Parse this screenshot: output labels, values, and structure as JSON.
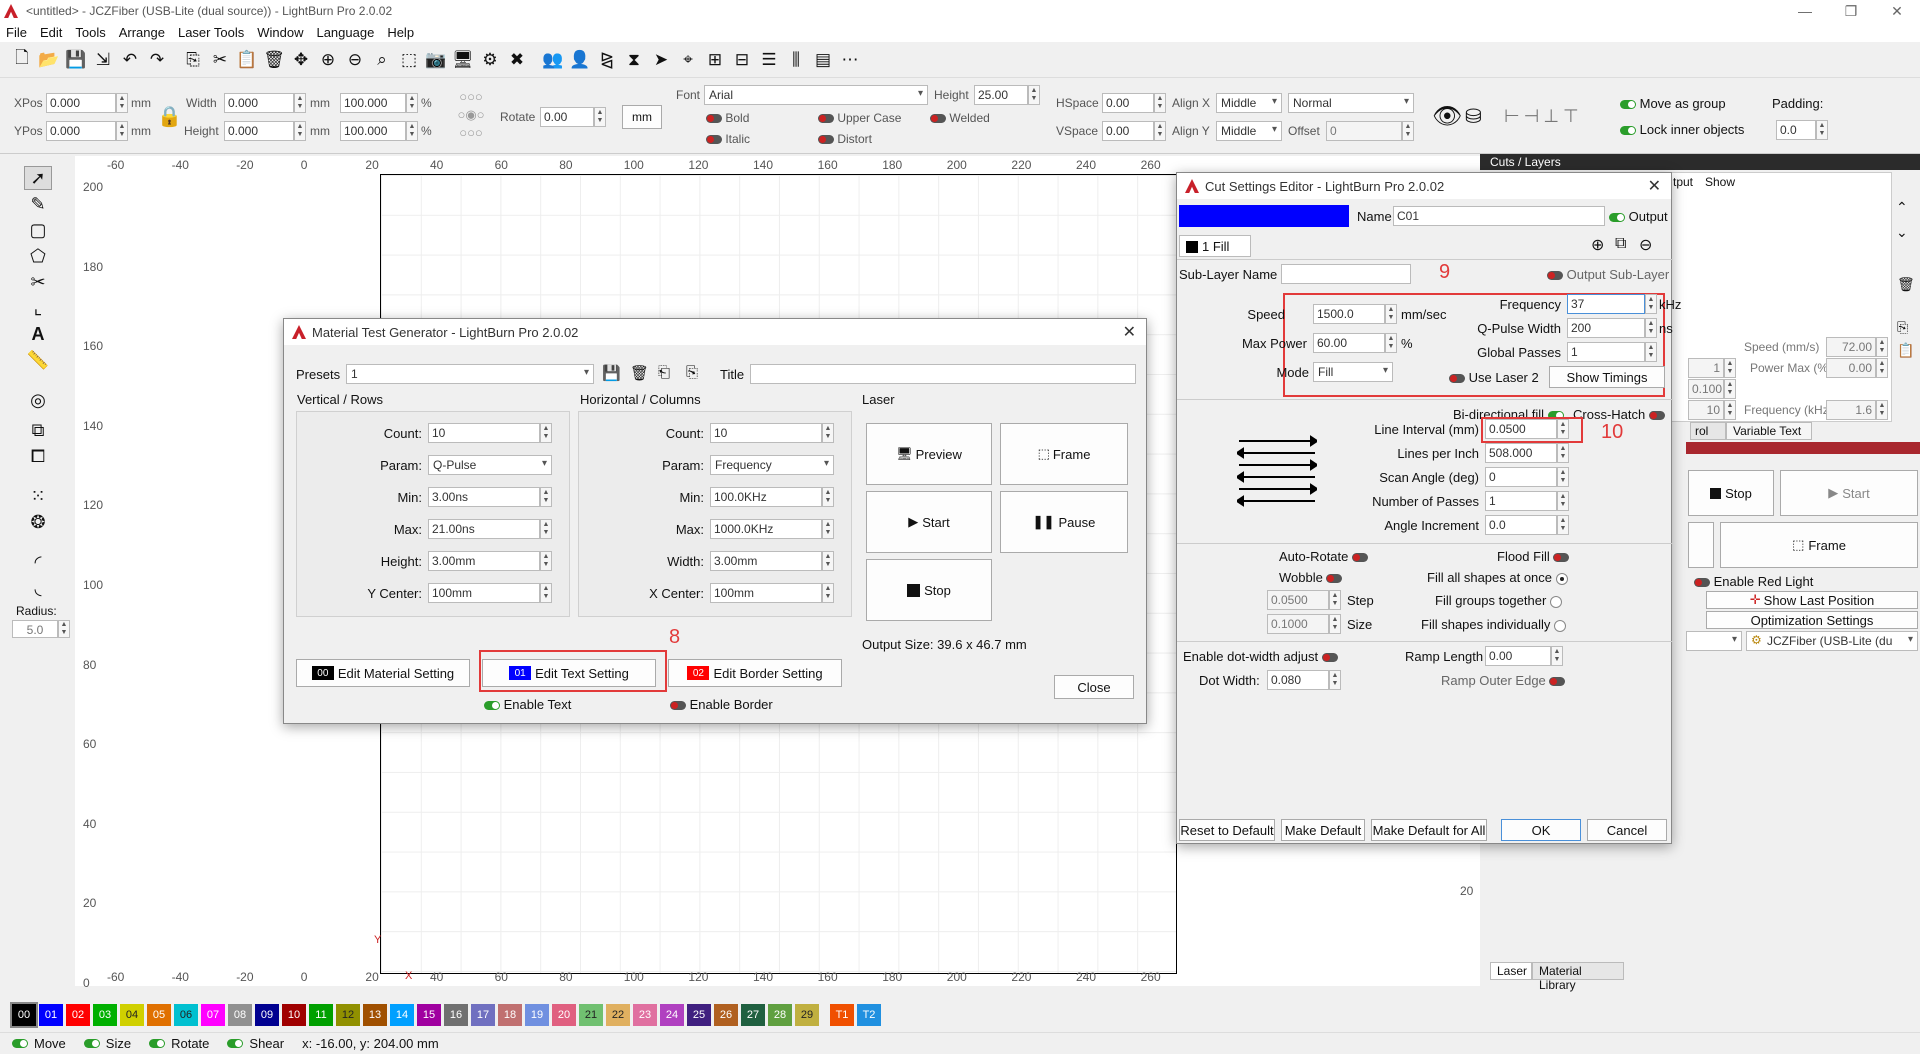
{
  "window": {
    "title": "<untitled> - JCZFiber (USB-Lite (dual source)) - LightBurn Pro 2.0.02",
    "minimize": "—",
    "maximize": "❐",
    "close": "✕"
  },
  "menu": [
    "File",
    "Edit",
    "Tools",
    "Arrange",
    "Laser Tools",
    "Window",
    "Language",
    "Help"
  ],
  "props": {
    "xpos_label": "XPos",
    "xpos": "0.000",
    "ypos_label": "YPos",
    "ypos": "0.000",
    "mm": "mm",
    "width_label": "Width",
    "width": "0.000",
    "height_label": "Height",
    "height": "0.000",
    "wpct": "100.000",
    "hpct": "100.000",
    "pct": "%",
    "rotate_label": "Rotate",
    "rotate": "0.00",
    "unit_btn": "mm",
    "font_label": "Font",
    "font": "Arial",
    "fheight_label": "Height",
    "fheight": "25.00",
    "bold": "Bold",
    "italic": "Italic",
    "upper": "Upper Case",
    "distort": "Distort",
    "welded": "Welded",
    "hspace_label": "HSpace",
    "hspace": "0.00",
    "vspace_label": "VSpace",
    "vspace": "0.00",
    "alignx_label": "Align X",
    "alignx": "Middle",
    "aligny_label": "Align Y",
    "aligny": "Middle",
    "normal": "Normal",
    "offset_label": "Offset",
    "offset": "0",
    "move_group": "Move as group",
    "lock_inner": "Lock inner objects",
    "padding_label": "Padding:",
    "padding": "0.0"
  },
  "rulers": {
    "top": [
      "-60",
      "-40",
      "-20",
      "0",
      "20",
      "40",
      "60",
      "80",
      "100",
      "120",
      "140",
      "160",
      "180",
      "200",
      "220",
      "240",
      "260"
    ],
    "left": [
      "200",
      "180",
      "160",
      "140",
      "120",
      "100",
      "80",
      "60",
      "40",
      "20",
      "0"
    ],
    "left_small": [
      "20"
    ],
    "bottom": [
      "-60",
      "-40",
      "-20",
      "0",
      "20",
      "40",
      "60",
      "80",
      "100",
      "120",
      "140",
      "160",
      "180",
      "200",
      "220",
      "240",
      "260"
    ],
    "x_marker": "X",
    "y_marker": "Y"
  },
  "radius": {
    "label": "Radius:",
    "value": "5.0"
  },
  "palette": [
    {
      "n": "00",
      "c": "#000000"
    },
    {
      "n": "01",
      "c": "#0000ff"
    },
    {
      "n": "02",
      "c": "#ff0000"
    },
    {
      "n": "03",
      "c": "#00b000"
    },
    {
      "n": "04",
      "c": "#d0d000"
    },
    {
      "n": "05",
      "c": "#e07000"
    },
    {
      "n": "06",
      "c": "#00c0d0"
    },
    {
      "n": "07",
      "c": "#ff00ff"
    },
    {
      "n": "08",
      "c": "#909090"
    },
    {
      "n": "09",
      "c": "#000090"
    },
    {
      "n": "10",
      "c": "#a00000"
    },
    {
      "n": "11",
      "c": "#00a000"
    },
    {
      "n": "12",
      "c": "#909000"
    },
    {
      "n": "13",
      "c": "#a05000"
    },
    {
      "n": "14",
      "c": "#00a0ff"
    },
    {
      "n": "15",
      "c": "#a000a0"
    },
    {
      "n": "16",
      "c": "#707070"
    },
    {
      "n": "17",
      "c": "#7070c0"
    },
    {
      "n": "18",
      "c": "#c07070"
    },
    {
      "n": "19",
      "c": "#7090e0"
    },
    {
      "n": "20",
      "c": "#e06080"
    },
    {
      "n": "21",
      "c": "#70c070"
    },
    {
      "n": "22",
      "c": "#e0b060"
    },
    {
      "n": "23",
      "c": "#e070a0"
    },
    {
      "n": "24",
      "c": "#b040c0"
    },
    {
      "n": "25",
      "c": "#402080"
    },
    {
      "n": "26",
      "c": "#b06020"
    },
    {
      "n": "27",
      "c": "#206040"
    },
    {
      "n": "28",
      "c": "#60a040"
    },
    {
      "n": "29",
      "c": "#c0b040"
    },
    {
      "n": "T1",
      "c": "#f05000"
    },
    {
      "n": "T2",
      "c": "#2090e0"
    }
  ],
  "status": {
    "move": "Move",
    "size": "Size",
    "rotate": "Rotate",
    "shear": "Shear",
    "coords": "x: -16.00, y: 204.00 mm"
  },
  "mtg": {
    "title": "Material Test Generator - LightBurn Pro 2.0.02",
    "presets_label": "Presets",
    "presets": "1",
    "title_label": "Title",
    "rows_header": "Vertical / Rows",
    "cols_header": "Horizontal / Columns",
    "laser_header": "Laser",
    "count_label": "Count:",
    "param_label": "Param:",
    "min_label": "Min:",
    "max_label": "Max:",
    "height_label": "Height:",
    "ycenter_label": "Y Center:",
    "width_label": "Width:",
    "xcenter_label": "X Center:",
    "rows": {
      "count": "10",
      "param": "Q-Pulse",
      "min": "3.00ns",
      "max": "21.00ns",
      "height": "3.00mm",
      "ycenter": "100mm"
    },
    "cols": {
      "count": "10",
      "param": "Frequency",
      "min": "100.0KHz",
      "max": "1000.0KHz",
      "width": "3.00mm",
      "xcenter": "100mm"
    },
    "preview": "Preview",
    "frame": "Frame",
    "start": "Start",
    "pause": "Pause",
    "stop": "Stop",
    "output_size": "Output Size: 39.6 x 46.7 mm",
    "edit_material": "Edit Material Setting",
    "edit_text": "Edit Text Setting",
    "edit_border": "Edit Border Setting",
    "chip00": "00",
    "chip01": "01",
    "chip02": "02",
    "enable_text": "Enable Text",
    "enable_border": "Enable Border",
    "close": "Close",
    "marker": "8"
  },
  "cse": {
    "title": "Cut Settings Editor - LightBurn Pro 2.0.02",
    "name_label": "Name",
    "name": "C01",
    "output": "Output",
    "tab": "1 Fill",
    "sublayer_label": "Sub-Layer Name",
    "output_sublayer": "Output Sub-Layer",
    "speed_label": "Speed",
    "speed": "1500.0",
    "speed_unit": "mm/sec",
    "maxpower_label": "Max Power",
    "maxpower": "60.00",
    "pct": "%",
    "mode_label": "Mode",
    "mode": "Fill",
    "freq_label": "Frequency",
    "freq": "37",
    "freq_unit": "kHz",
    "qpulse_label": "Q-Pulse Width",
    "qpulse": "200",
    "qpulse_unit": "ns",
    "passes_label": "Global Passes",
    "passes": "1",
    "uselaser2": "Use Laser 2",
    "show_timings": "Show Timings",
    "bidir": "Bi-directional fill",
    "crosshatch": "Cross-Hatch",
    "interval_label": "Line Interval (mm)",
    "interval": "0.0500",
    "lpi_label": "Lines per Inch",
    "lpi": "508.000",
    "scan_label": "Scan Angle (deg)",
    "scan": "0",
    "npasses_label": "Number of Passes",
    "npasses": "1",
    "angle_inc_label": "Angle Increment",
    "angle_inc": "0.0",
    "autorotate": "Auto-Rotate",
    "floodfill": "Flood Fill",
    "wobble": "Wobble",
    "fill_once": "Fill all shapes at once",
    "step_val": "0.0500",
    "step": "Step",
    "fill_groups": "Fill groups together",
    "size_val": "0.1000",
    "size": "Size",
    "fill_indiv": "Fill shapes individually",
    "dotwidth_enable": "Enable dot-width adjust",
    "ramp_label": "Ramp Length",
    "ramp": "0.00",
    "dotwidth_label": "Dot Width:",
    "dotwidth": "0.080",
    "ramp_outer": "Ramp Outer Edge",
    "reset": "Reset to Default",
    "make_default": "Make Default",
    "make_all": "Make Default for All",
    "ok": "OK",
    "cancel": "Cancel",
    "marker9": "9",
    "marker10": "10"
  },
  "right": {
    "cuts_title": "Cuts / Layers",
    "col_output": "tput",
    "col_show": "Show",
    "speed_label": "Speed (mm/s)",
    "speed": "72.00",
    "power_label": "Power Max (%)",
    "power": "0.00",
    "v1": "1",
    "v2": "0.100",
    "v3": "10",
    "freq_label": "Frequency (kHz)",
    "freq": "1.6",
    "tab_control": "rol",
    "tab_vartext": "Variable Text",
    "stop": "Stop",
    "start": "Start",
    "frame": "Frame",
    "red_light": "Enable Red Light",
    "show_last": "Show Last Position",
    "optim": "Optimization Settings",
    "device": "JCZFiber (USB-Lite (du",
    "tab_laser": "Laser",
    "tab_matlib": "Material Library"
  },
  "colors": {
    "accent": "#0000ff",
    "highlight": "#e23a3a",
    "toggle_on": "#2a9d2a"
  }
}
